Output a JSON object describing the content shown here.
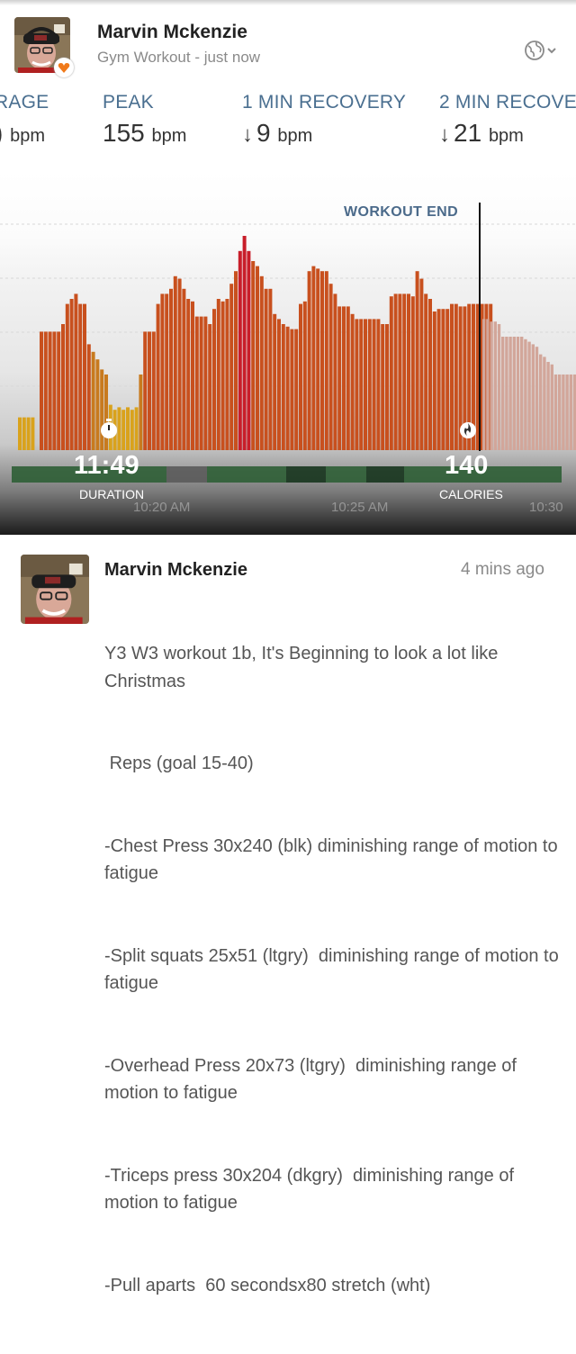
{
  "header": {
    "user_name": "Marvin Mckenzie",
    "subtitle": "Gym Workout - just now",
    "badge_icon": "heart-icon",
    "privacy_icon": "globe-icon",
    "dropdown_icon": "chevron-down-icon"
  },
  "stats": [
    {
      "label": "RAGE",
      "value": ")",
      "unit": "bpm",
      "arrow": ""
    },
    {
      "label": "PEAK",
      "value": "155",
      "unit": "bpm",
      "arrow": ""
    },
    {
      "label": "1 MIN RECOVERY",
      "value": "9",
      "unit": "bpm",
      "arrow": "↓"
    },
    {
      "label": "2 MIN RECOVE",
      "value": "21",
      "unit": "bpm",
      "arrow": "↓"
    }
  ],
  "chart": {
    "workout_end_label": "WORKOUT END",
    "duration_value": "11:49",
    "duration_label": "DURATION",
    "duration_icon": "stopwatch-icon",
    "calories_value": "140",
    "calories_label": "CALORIES",
    "calories_icon": "flame-icon",
    "time_labels": [
      "10:20 AM",
      "10:25 AM",
      "10:30"
    ],
    "colors": {
      "low": "#d9a21c",
      "mid": "#c87a1e",
      "high": "#c8501e",
      "peak": "#c81e2a",
      "after": "#d2a69a",
      "end_line": "#111111"
    }
  },
  "chart_data": {
    "type": "bar",
    "values": [
      0.13,
      0.13,
      0.13,
      0.13,
      0,
      0.47,
      0.47,
      0.47,
      0.47,
      0.47,
      0.5,
      0.58,
      0.6,
      0.62,
      0.58,
      0.58,
      0.42,
      0.39,
      0.36,
      0.32,
      0.3,
      0.18,
      0.16,
      0.17,
      0.16,
      0.17,
      0.16,
      0.17,
      0.3,
      0.47,
      0.47,
      0.47,
      0.58,
      0.62,
      0.62,
      0.64,
      0.69,
      0.68,
      0.64,
      0.6,
      0.59,
      0.53,
      0.53,
      0.53,
      0.5,
      0.56,
      0.6,
      0.59,
      0.6,
      0.66,
      0.71,
      0.79,
      0.85,
      0.79,
      0.75,
      0.73,
      0.69,
      0.64,
      0.64,
      0.54,
      0.52,
      0.5,
      0.49,
      0.48,
      0.48,
      0.58,
      0.59,
      0.71,
      0.73,
      0.72,
      0.71,
      0.71,
      0.66,
      0.62,
      0.57,
      0.57,
      0.57,
      0.54,
      0.52,
      0.52,
      0.52,
      0.52,
      0.52,
      0.52,
      0.5,
      0.5,
      0.61,
      0.62,
      0.62,
      0.62,
      0.62,
      0.61,
      0.71,
      0.68,
      0.62,
      0.6,
      0.55,
      0.56,
      0.56,
      0.56,
      0.58,
      0.58,
      0.57,
      0.57,
      0.58,
      0.58,
      0.58,
      0.58,
      0.58,
      0.58
    ],
    "after_values": [
      0.52,
      0.52,
      0.51,
      0.51,
      0.5,
      0.45,
      0.45,
      0.45,
      0.45,
      0.45,
      0.45,
      0.44,
      0.43,
      0.42,
      0.41,
      0.38,
      0.37,
      0.35,
      0.34,
      0.3,
      0.3,
      0.3,
      0.3,
      0.3,
      0.3
    ],
    "ylim": [
      0,
      1
    ]
  },
  "post": {
    "user_name": "Marvin Mckenzie",
    "time": "4 mins ago",
    "lines": [
      "Y3 W3 workout 1b, It's Beginning to look a lot like Christmas",
      " Reps (goal 15-40)",
      "-Chest Press 30x240 (blk) diminishing range of motion to fatigue",
      "-Split squats 25x51 (ltgry)  diminishing range of motion to fatigue",
      "-Overhead Press 20x73 (ltgry)  diminishing range of motion to fatigue",
      "-Triceps press 30x204 (dkgry)  diminishing range of motion to fatigue",
      "-Pull aparts  60 secondsx80 stretch (wht)"
    ]
  }
}
